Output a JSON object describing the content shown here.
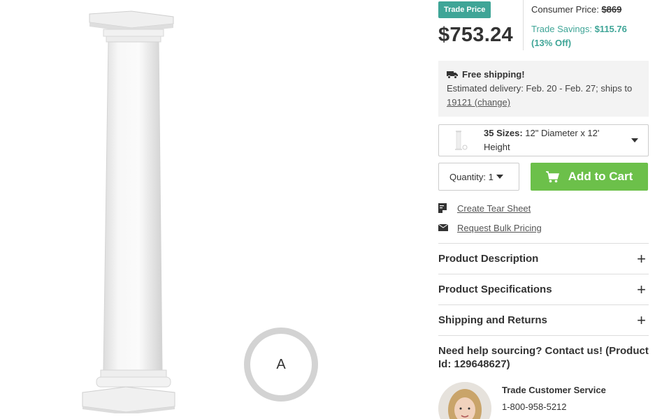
{
  "gallery": {
    "ar_badge_label": "A"
  },
  "pricing": {
    "trade_badge": "Trade Price",
    "trade_price": "$753.24",
    "consumer_label": "Consumer Price:",
    "consumer_price": "$869",
    "savings_label": "Trade Savings:",
    "savings_amount": "$115.76",
    "savings_percent": "(13% Off)"
  },
  "shipping": {
    "title": "Free shipping!",
    "estimate": "Estimated delivery: Feb. 20 - Feb. 27; ships to",
    "zip_link": "19121 (change)"
  },
  "size_select": {
    "count_label": "35 Sizes:",
    "value": "12\" Diameter x 12' Height"
  },
  "cart": {
    "quantity_label": "Quantity: 1",
    "add_label": "Add to Cart"
  },
  "links": {
    "tear_sheet": "Create Tear Sheet",
    "bulk_pricing": "Request Bulk Pricing"
  },
  "accordion": [
    {
      "label": "Product Description"
    },
    {
      "label": "Product Specifications"
    },
    {
      "label": "Shipping and Returns"
    }
  ],
  "help": {
    "heading": "Need help sourcing? Contact us! (Product Id: 129648627)",
    "contact_name": "Trade Customer Service",
    "contact_phone": "1-800-958-5212"
  },
  "colors": {
    "trade_teal": "#3fa597",
    "cart_green": "#6cc04a",
    "shipping_bg": "#f3f3f3"
  }
}
